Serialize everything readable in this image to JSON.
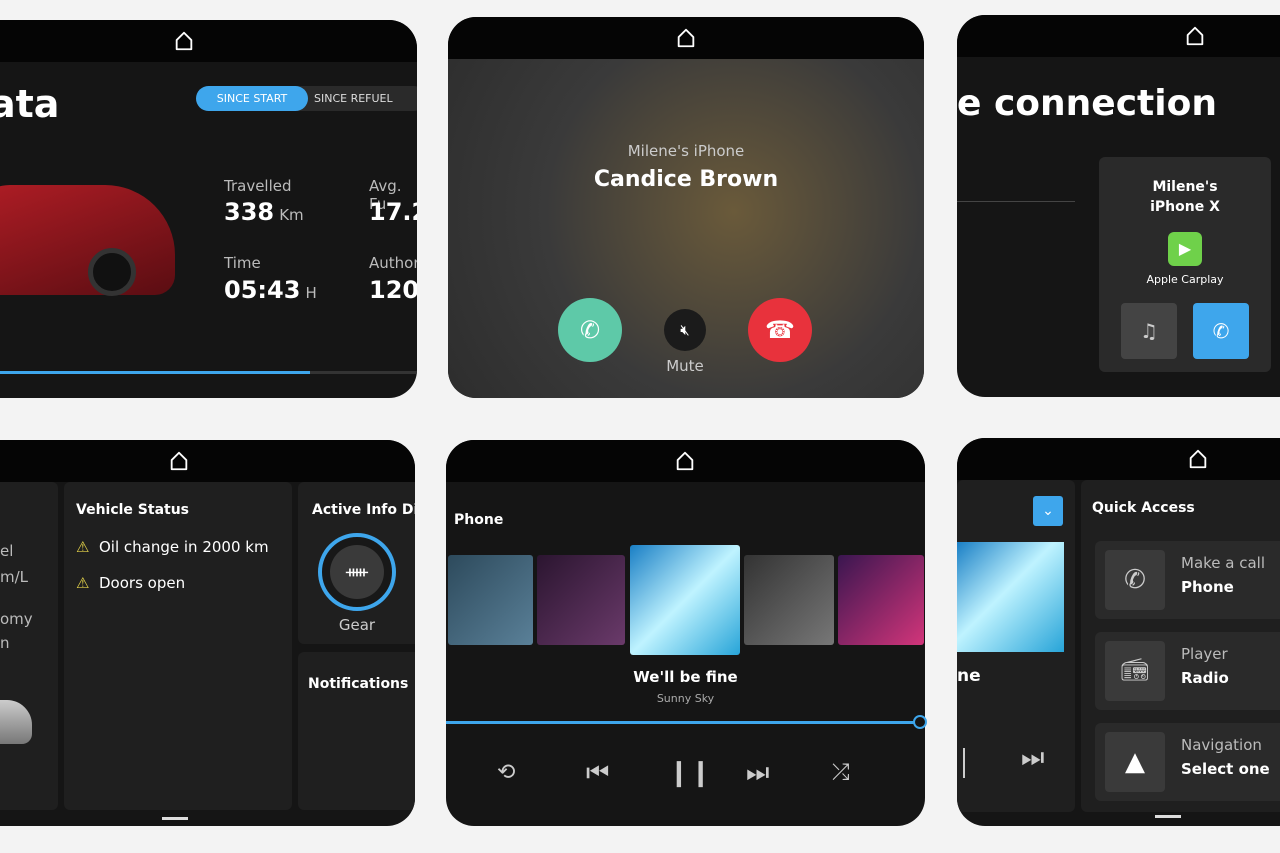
{
  "trip": {
    "title": "ata",
    "tabs": [
      "SINCE START",
      "SINCE REFUEL"
    ],
    "active_tab": 0,
    "stats": [
      {
        "label": "Travelled",
        "value": "338",
        "unit": "Km"
      },
      {
        "label": "Avg. Fu",
        "value": "17.2",
        "unit": ""
      },
      {
        "label": "Time",
        "value": "05:43",
        "unit": "H"
      },
      {
        "label": "Author",
        "value": "120",
        "unit": ""
      }
    ],
    "progress": 0.76
  },
  "call": {
    "device": "Milene's iPhone",
    "caller": "Candice Brown",
    "mute_label": "Mute"
  },
  "connection": {
    "title": "e connection",
    "device_name": "Milene's iPhone X",
    "service": "Apple Carplay"
  },
  "dashboard": {
    "left_partial": [
      "el",
      "m/L",
      "omy",
      "n"
    ],
    "vehicle_status_title": "Vehicle Status",
    "alerts": [
      "Oil change in 2000 km",
      "Doors open"
    ],
    "active_info_title": "Active Info Dis",
    "gear_label": "Gear",
    "notifications_title": "Notifications"
  },
  "player": {
    "source": "Phone",
    "track": "We'll be fine",
    "artist": "Sunny Sky",
    "progress": 0.99
  },
  "quick": {
    "partial_track": "ne",
    "title": "Quick Access",
    "items": [
      {
        "sub": "Make a call",
        "main": "Phone",
        "icon": "phone-icon"
      },
      {
        "sub": "Player",
        "main": "Radio",
        "icon": "radio-icon"
      },
      {
        "sub": "Navigation",
        "main": "Select one",
        "icon": "navigation-arrow-icon"
      }
    ]
  },
  "colors": {
    "accent": "#3ea6ec",
    "answer": "#5ec9a8",
    "hangup": "#e8323c",
    "warning": "#e5d34a",
    "carplay": "#6fd14a"
  }
}
